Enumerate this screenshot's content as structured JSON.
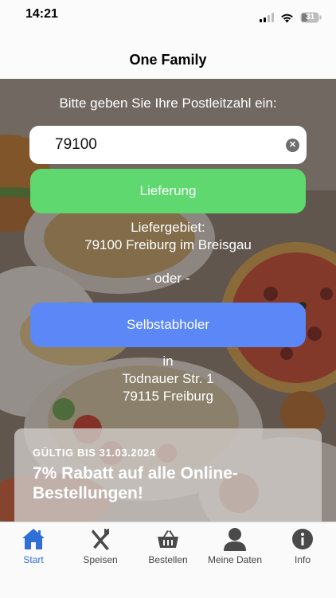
{
  "status_bar": {
    "time": "14:21",
    "battery": "31"
  },
  "nav": {
    "title": "One Family"
  },
  "form": {
    "prompt": "Bitte geben Sie Ihre Postleitzahl ein:",
    "zip_value": "79100",
    "clear_icon": "clear-circle-icon",
    "delivery_button": "Lieferung",
    "delivery_area_label": "Liefergebiet:",
    "delivery_area_value": "79100 Freiburg im Breisgau",
    "or_label": "- oder -",
    "pickup_button": "Selbstabholer",
    "pickup_in": "in",
    "pickup_street": "Todnauer Str. 1",
    "pickup_city": "79115 Freiburg"
  },
  "promo": {
    "valid_until": "GÜLTIG BIS 31.03.2024",
    "title": "7% Rabatt auf alle Online-Bestellungen!"
  },
  "tabs": [
    {
      "label": "Start",
      "icon": "home-icon",
      "active": true
    },
    {
      "label": "Speisen",
      "icon": "cutlery-icon",
      "active": false
    },
    {
      "label": "Bestellen",
      "icon": "basket-icon",
      "active": false
    },
    {
      "label": "Meine Daten",
      "icon": "person-icon",
      "active": false
    },
    {
      "label": "Info",
      "icon": "info-icon",
      "active": false
    }
  ],
  "colors": {
    "delivery_button": "#5fd96f",
    "pickup_button": "#5b87f7",
    "active_tab": "#2f6fd6",
    "inactive_tab_icon": "#4a4a4a"
  }
}
